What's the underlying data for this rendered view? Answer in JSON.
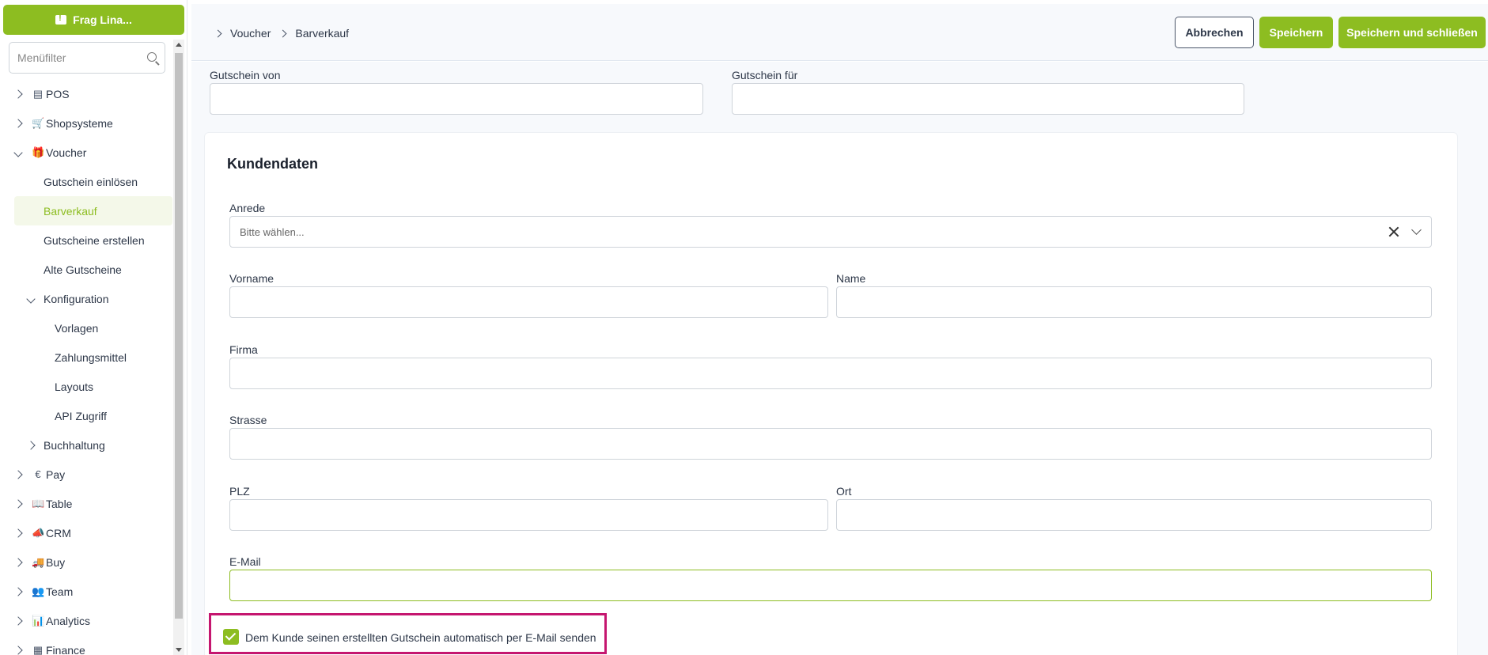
{
  "sidebar": {
    "ask_label": "Frag Lina...",
    "filter_placeholder": "Menüfilter",
    "items": [
      {
        "label": "POS",
        "icon": "register-icon"
      },
      {
        "label": "Shopsysteme",
        "icon": "cart-icon"
      },
      {
        "label": "Voucher",
        "icon": "gift-icon"
      },
      {
        "label": "Gutschein einlösen"
      },
      {
        "label": "Barverkauf"
      },
      {
        "label": "Gutscheine erstellen"
      },
      {
        "label": "Alte Gutscheine"
      },
      {
        "label": "Konfiguration"
      },
      {
        "label": "Vorlagen"
      },
      {
        "label": "Zahlungsmittel"
      },
      {
        "label": "Layouts"
      },
      {
        "label": "API Zugriff"
      },
      {
        "label": "Buchhaltung"
      },
      {
        "label": "Pay",
        "icon": "euro-icon"
      },
      {
        "label": "Table",
        "icon": "book-icon"
      },
      {
        "label": "CRM",
        "icon": "megaphone-icon"
      },
      {
        "label": "Buy",
        "icon": "truck-icon"
      },
      {
        "label": "Team",
        "icon": "users-icon"
      },
      {
        "label": "Analytics",
        "icon": "chart-icon"
      },
      {
        "label": "Finance",
        "icon": "calculator-icon"
      }
    ]
  },
  "header": {
    "breadcrumb": [
      "Voucher",
      "Barverkauf"
    ],
    "cancel_label": "Abbrechen",
    "save_label": "Speichern",
    "save_close_label": "Speichern und schließen"
  },
  "form": {
    "voucher_from_label": "Gutschein von",
    "voucher_for_label": "Gutschein für",
    "section_title": "Kundendaten",
    "salutation_label": "Anrede",
    "salutation_placeholder": "Bitte wählen...",
    "firstname_label": "Vorname",
    "name_label": "Name",
    "company_label": "Firma",
    "street_label": "Strasse",
    "zip_label": "PLZ",
    "city_label": "Ort",
    "email_label": "E-Mail",
    "auto_send_label": "Dem Kunde seinen erstellten Gutschein automatisch per E-Mail senden"
  },
  "colors": {
    "accent": "#8dbd21",
    "highlight": "#c5166f"
  }
}
